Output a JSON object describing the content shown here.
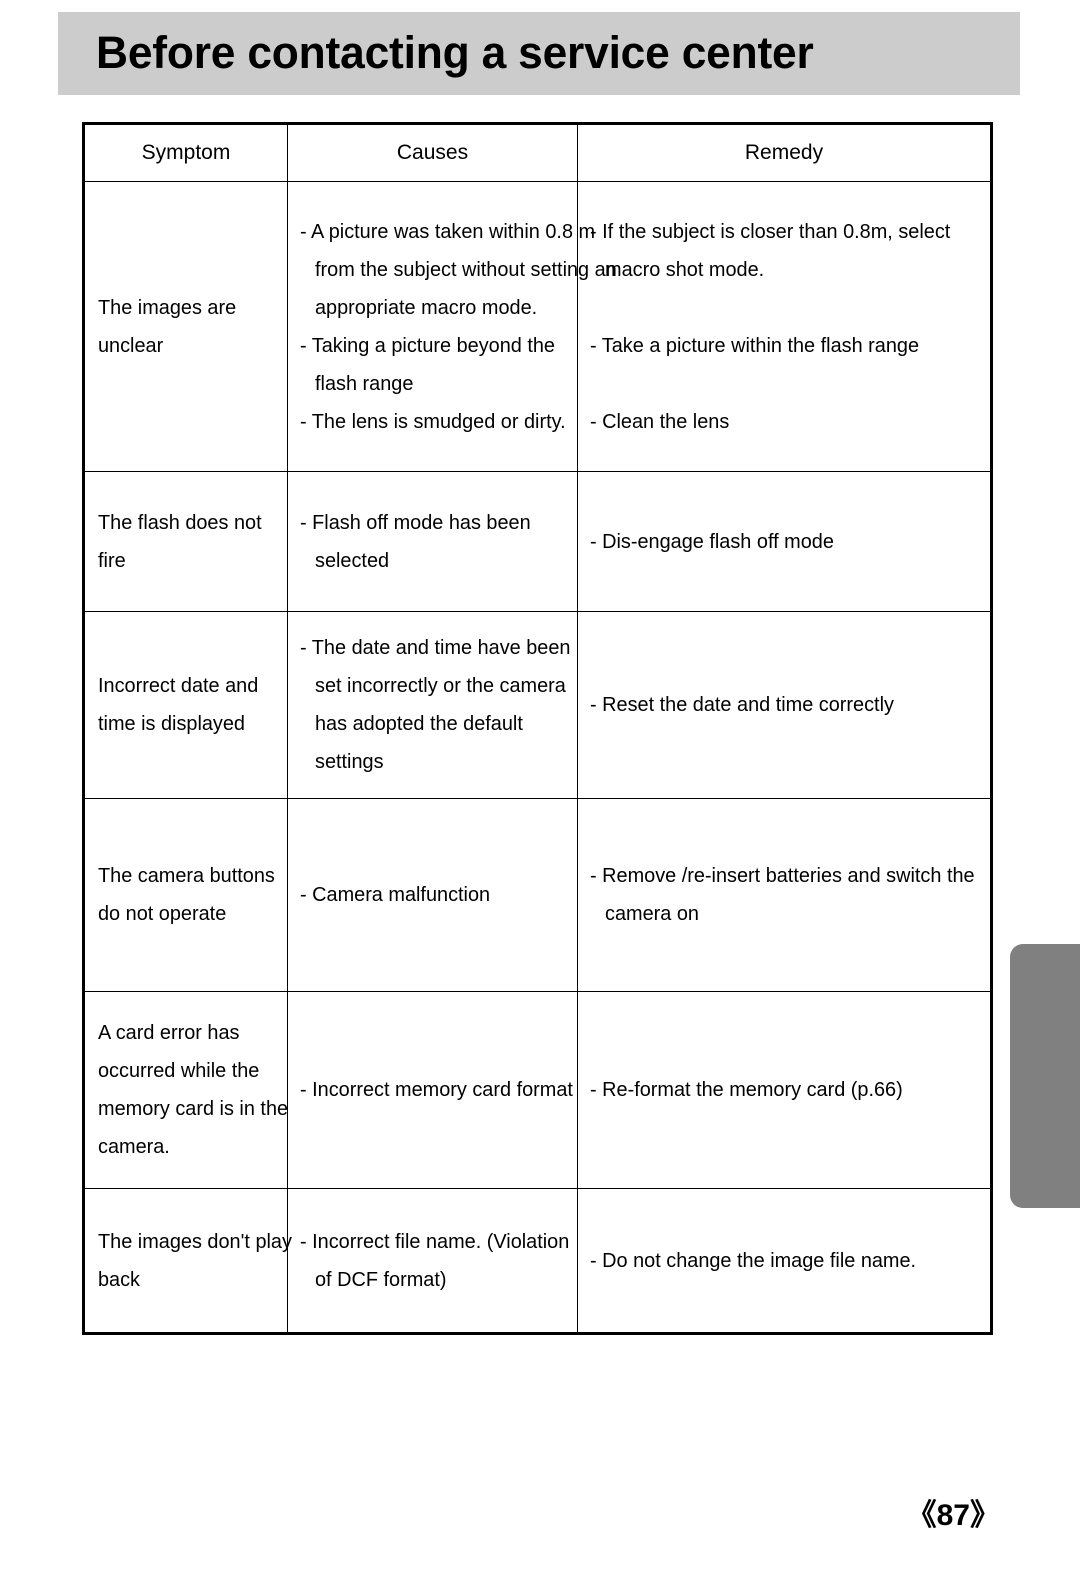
{
  "header": {
    "title": "Before contacting a service center",
    "band_color": "#cccccc"
  },
  "side_tab": {
    "color": "#808080"
  },
  "table": {
    "columns": [
      "Symptom",
      "Causes",
      "Remedy"
    ],
    "rows": [
      {
        "symptom": [
          "The images are",
          "unclear"
        ],
        "causes": [
          [
            "A picture was taken within 0.8 m",
            "from the subject without setting an",
            "appropriate macro mode."
          ],
          [
            "Taking a picture beyond the",
            "flash range"
          ],
          [
            "The lens is smudged or dirty."
          ]
        ],
        "remedy": [
          [
            "If the subject is closer than 0.8m, select",
            "macro shot mode."
          ],
          [
            "Take a picture within the flash range"
          ],
          [
            "Clean the lens"
          ]
        ],
        "remedy_spaced": true
      },
      {
        "symptom": [
          "The flash does not",
          "fire"
        ],
        "causes": [
          [
            "Flash off mode has been",
            "selected"
          ]
        ],
        "remedy": [
          [
            "Dis-engage flash off mode"
          ]
        ],
        "remedy_spaced": false
      },
      {
        "symptom": [
          "Incorrect date and",
          "time is displayed"
        ],
        "causes": [
          [
            "The date and time have been",
            "set incorrectly or the camera",
            "has adopted the default",
            "settings"
          ]
        ],
        "remedy": [
          [
            "Reset the date and time correctly"
          ]
        ],
        "remedy_spaced": false
      },
      {
        "symptom": [
          "The camera buttons",
          "do not operate"
        ],
        "causes": [
          [
            "Camera malfunction"
          ]
        ],
        "remedy": [
          [
            "Remove /re-insert batteries and switch the",
            "camera on"
          ]
        ],
        "remedy_spaced": false
      },
      {
        "symptom": [
          "A card error has",
          "occurred while the",
          "memory card is in the",
          "camera."
        ],
        "causes": [
          [
            "Incorrect memory card format"
          ]
        ],
        "remedy": [
          [
            "Re-format the memory card (p.66)"
          ]
        ],
        "remedy_spaced": false
      },
      {
        "symptom": [
          "The images don't play",
          "back"
        ],
        "causes": [
          [
            "Incorrect file name. (Violation",
            "of DCF format)"
          ]
        ],
        "remedy": [
          [
            "Do not change the image file name."
          ]
        ],
        "remedy_spaced": false
      }
    ],
    "bullet_marker": "-"
  },
  "footer": {
    "page_number": "《87》"
  }
}
